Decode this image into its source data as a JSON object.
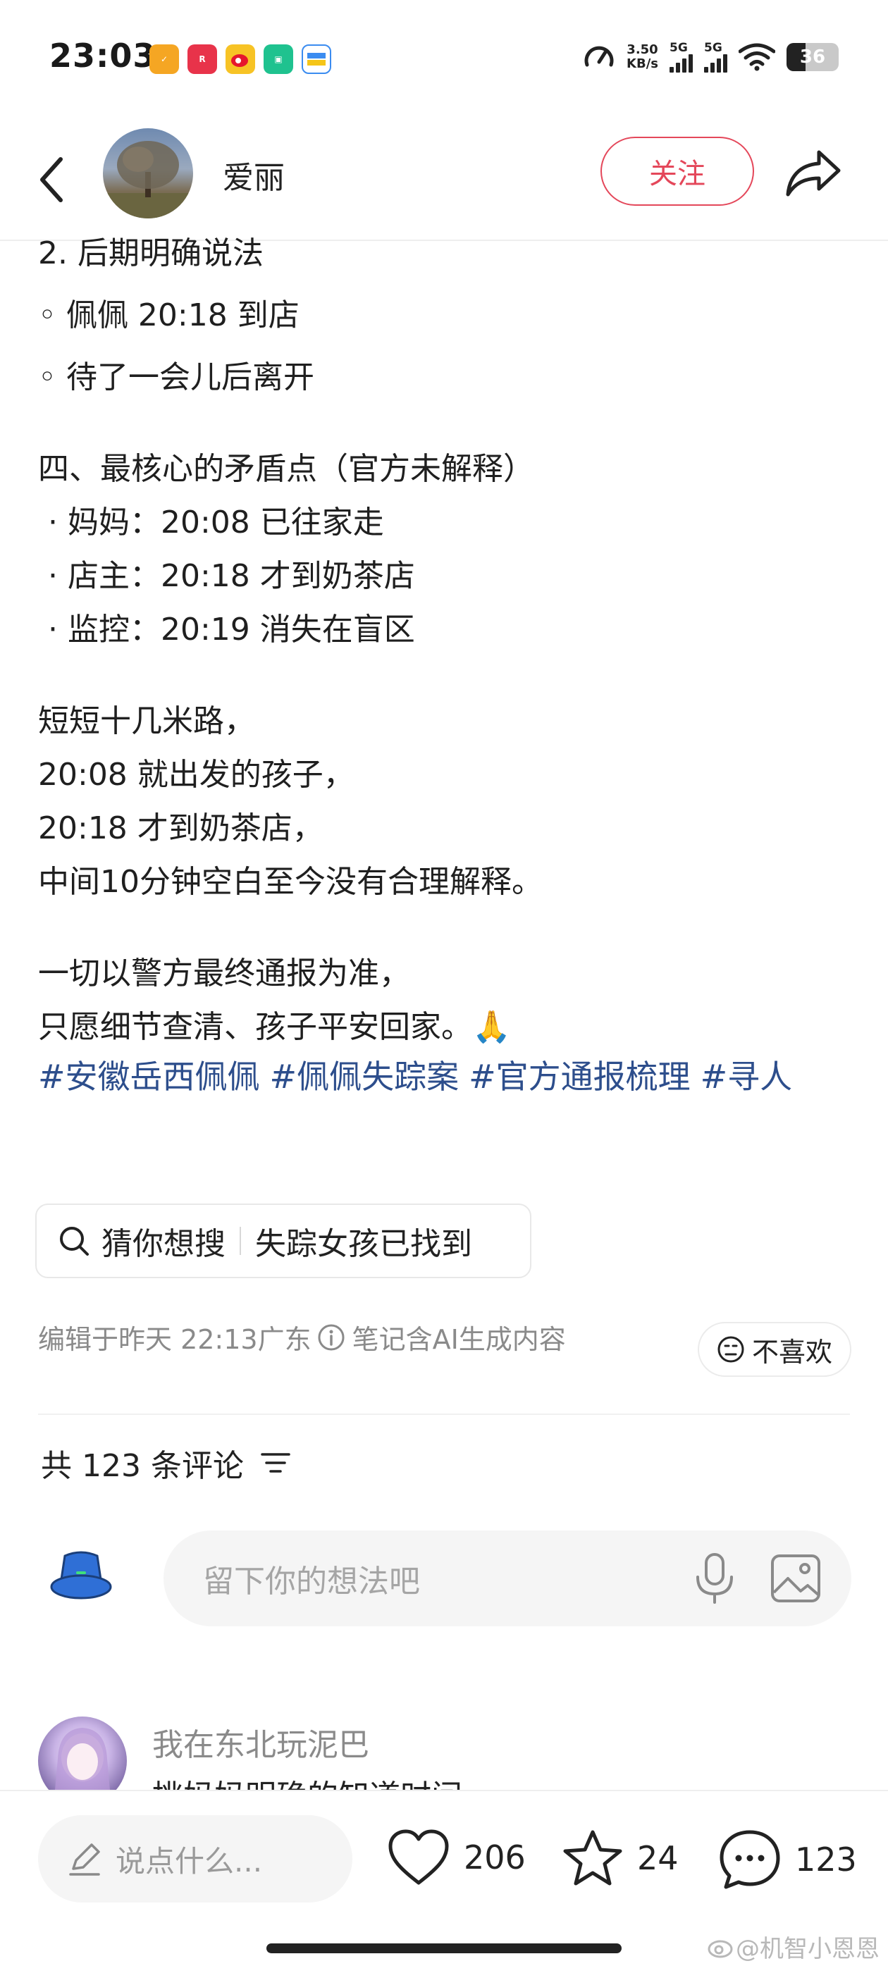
{
  "status_bar": {
    "time": "23:03",
    "net_speed_value": "3.50",
    "net_speed_unit": "KB/s",
    "signal_1_label": "5G",
    "signal_2_label": "5G",
    "battery": "36"
  },
  "header": {
    "author_name": "爱丽",
    "follow_label": "关注"
  },
  "content": {
    "lines_a": [
      "2. 后期明确说法",
      "◦ 佩佩 20:18 到店",
      "◦ 待了一会儿后离开"
    ],
    "section_title": "四、最核心的矛盾点（官方未解释）",
    "bullets": [
      "·  妈妈：20:08 已往家走",
      "·  店主：20:18 才到奶茶店",
      "·  监控：20:19 消失在盲区"
    ],
    "para_1": [
      "短短十几米路，",
      "20:08 就出发的孩子，",
      "20:18 才到奶茶店，",
      "中间10分钟空白至今没有合理解释。"
    ],
    "para_2": [
      "一切以警方最终通报为准，",
      "只愿细节查清、孩子平安回家。🙏"
    ],
    "hashtags": [
      "#安徽岳西佩佩",
      "#佩佩失踪案",
      "#官方通报梳理",
      "#寻人"
    ]
  },
  "search_chip": {
    "prefix": "猜你想搜",
    "term": "失踪女孩已找到"
  },
  "meta": {
    "edited": "编辑于昨天 22:13广东",
    "ai_note": "笔记含AI生成内容",
    "dislike_label": "不喜欢"
  },
  "comments": {
    "count_label": "共 123 条评论",
    "input_placeholder": "留下你的想法吧",
    "first_comment": {
      "user": "我在东北玩泥巴",
      "text": "挑妈妈明确的知道时间"
    }
  },
  "bottom_bar": {
    "say_placeholder": "说点什么...",
    "likes": "206",
    "favorites": "24",
    "comments": "123"
  },
  "watermark": "@机智小恩恩",
  "colors": {
    "accent_red": "#e4475a",
    "hashtag_blue": "#2d4e8c"
  }
}
